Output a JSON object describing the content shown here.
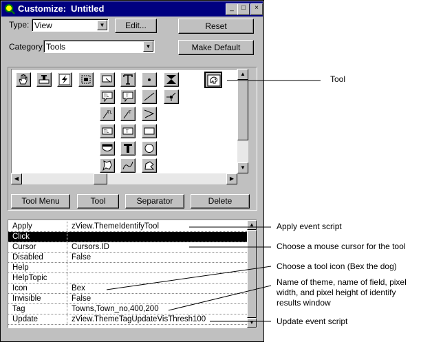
{
  "window": {
    "title_app": "Customize:",
    "title_doc": "Untitled",
    "controls": [
      "_",
      "□",
      "×"
    ]
  },
  "top": {
    "type_label": "Type:",
    "type_value": "View",
    "category_label": "Category:",
    "category_value": "Tools",
    "edit_button": "Edit...",
    "reset_button": "Reset",
    "make_default_button": "Make Default"
  },
  "tools": {
    "icons": [
      "hand-icon",
      "stamp-icon",
      "lightning-icon",
      "select-box-icon",
      "label-pointer-icon",
      "text-t-icon",
      "dot-point-icon",
      "hourglass-icon",
      "bex-dog-icon",
      "tl-callout-icon",
      "t-callout-icon",
      "line-icon",
      "vertex-icon",
      "tl-arrow-icon",
      "t-arrow-icon",
      "polyline-icon",
      "tl-box-icon",
      "t-box-icon",
      "rectangle-icon",
      "shield-icon",
      "bold-t-icon",
      "circle-icon",
      "shape-icon",
      "curve-icon",
      "polygon-icon"
    ],
    "buttons": {
      "tool_menu": "Tool Menu",
      "tool": "Tool",
      "separator": "Separator",
      "delete": "Delete"
    }
  },
  "properties": {
    "rows": [
      {
        "key": "Apply",
        "value": "zView.ThemeIdentifyTool"
      },
      {
        "key": "Click",
        "value": ""
      },
      {
        "key": "Cursor",
        "value": "Cursors.ID"
      },
      {
        "key": "Disabled",
        "value": "False"
      },
      {
        "key": "Help",
        "value": ""
      },
      {
        "key": "HelpTopic",
        "value": ""
      },
      {
        "key": "Icon",
        "value": "Bex"
      },
      {
        "key": "Invisible",
        "value": "False"
      },
      {
        "key": "Tag",
        "value": "Towns,Town_no,400,200"
      },
      {
        "key": "Update",
        "value": "zView.ThemeTagUpdateVisThresh100"
      }
    ],
    "selected_row": "Click"
  },
  "callouts": {
    "tool": "Tool",
    "apply": "Apply event script",
    "cursor": "Choose a mouse cursor for the tool",
    "icon": "Choose a tool icon (Bex the dog)",
    "tag_line1": "Name of theme, name of field, pixel",
    "tag_line2": "width, and pixel height of identify",
    "tag_line3": "results window",
    "update": "Update event script"
  }
}
